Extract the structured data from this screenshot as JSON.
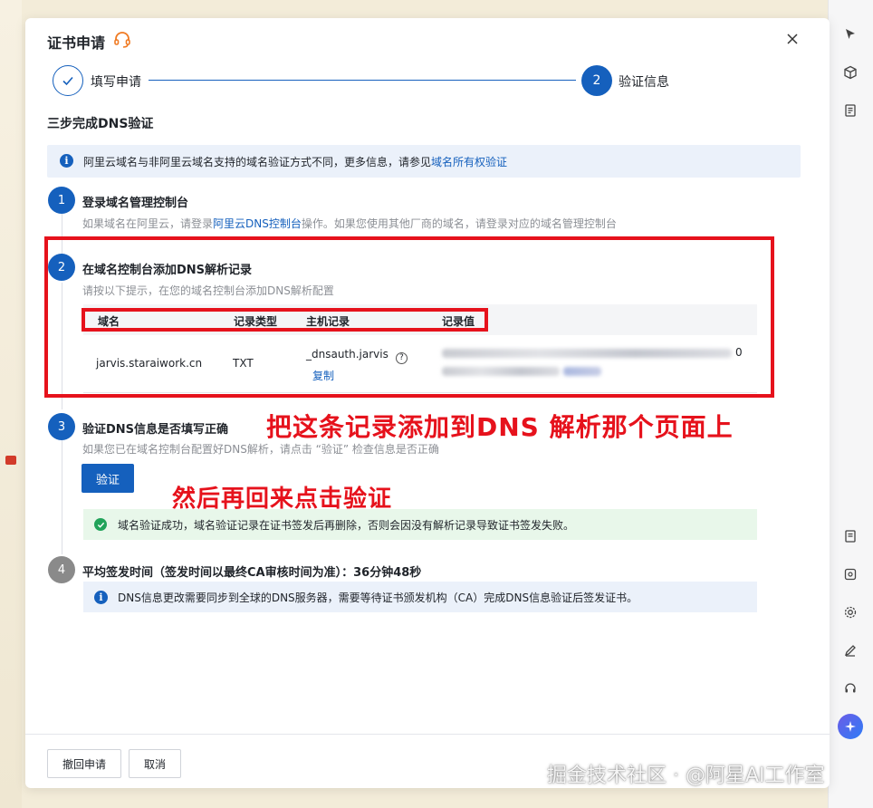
{
  "dialog": {
    "title": "证书申请",
    "steps": [
      {
        "label": "填写申请"
      },
      {
        "number": "2",
        "label": "验证信息"
      }
    ]
  },
  "section_title": "三步完成DNS验证",
  "info": {
    "text": "阿里云域名与非阿里云域名支持的域名验证方式不同，更多信息，请参见",
    "link": "域名所有权验证"
  },
  "step1": {
    "number": "1",
    "title": "登录域名管理控制台",
    "desc_pre": "如果域名在阿里云，请登录",
    "desc_link": "阿里云DNS控制台",
    "desc_post": "操作。如果您使用其他厂商的域名，请登录对应的域名管理控制台"
  },
  "step2": {
    "number": "2",
    "title": "在域名控制台添加DNS解析记录",
    "desc": "请按以下提示，在您的域名控制台添加DNS解析配置",
    "table": {
      "headers": [
        "域名",
        "记录类型",
        "主机记录",
        "记录值"
      ],
      "row": {
        "domain": "jarvis.staraiwork.cn",
        "type": "TXT",
        "host": "_dnsauth.jarvis",
        "copy": "复制",
        "value_tail": "0"
      }
    }
  },
  "step3": {
    "number": "3",
    "title": "验证DNS信息是否填写正确",
    "desc": "如果您已在域名控制台配置好DNS解析，请点击 “验证” 检查信息是否正确",
    "verify_button": "验证",
    "success": "域名验证成功，域名验证记录在证书签发后再删除，否则会因没有解析记录导致证书签发失败。"
  },
  "step4": {
    "number": "4",
    "title": "平均签发时间（签发时间以最终CA审核时间为准）：36分钟48秒",
    "note": "DNS信息更改需要同步到全球的DNS服务器，需要等待证书颁发机构（CA）完成DNS信息验证后签发证书。"
  },
  "footer": {
    "withdraw": "撤回申请",
    "cancel": "取消"
  },
  "annotations": {
    "line1": "把这条记录添加到DNS 解析那个页面上",
    "line2": "然后再回来点击验证"
  },
  "watermark": "掘金技术社区 · @阿星AI工作室",
  "colors": {
    "primary": "#1560bd",
    "annotation_red": "#e6121c",
    "success_green": "#21a35a",
    "info_bg": "#ebf1fa",
    "success_bg": "#e8f7ea"
  }
}
